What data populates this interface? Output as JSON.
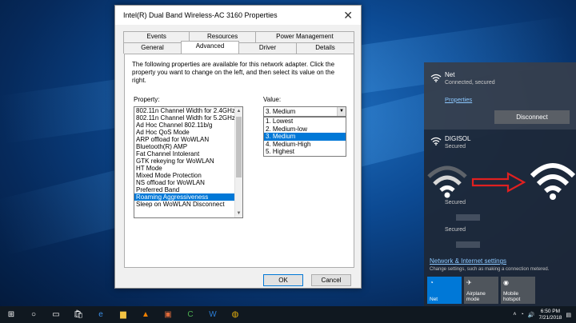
{
  "dialog": {
    "title": "Intel(R) Dual Band Wireless-AC 3160 Properties",
    "tabs_row1": [
      "Events",
      "Resources",
      "Power Management"
    ],
    "tabs_row2": [
      "General",
      "Advanced",
      "Driver",
      "Details"
    ],
    "active_tab": "Advanced",
    "description": "The following properties are available for this network adapter. Click the property you want to change on the left, and then select its value on the right.",
    "property_label": "Property:",
    "value_label": "Value:",
    "properties": [
      "802.11n Channel Width for 2.4GHz",
      "802.11n Channel Width for 5.2GHz",
      "Ad Hoc Channel 802.11b/g",
      "Ad Hoc QoS Mode",
      "ARP offload for WoWLAN",
      "Bluetooth(R) AMP",
      "Fat Channel Intolerant",
      "GTK rekeying for WoWLAN",
      "HT Mode",
      "Mixed Mode Protection",
      "NS offload for WoWLAN",
      "Preferred Band",
      "Roaming Aggressiveness",
      "Sleep on WoWLAN Disconnect"
    ],
    "selected_property": "Roaming Aggressiveness",
    "value_current": "3. Medium",
    "value_options": [
      "1. Lowest",
      "2. Medium-low",
      "3. Medium",
      "4. Medium-High",
      "5. Highest"
    ],
    "ok_label": "OK",
    "cancel_label": "Cancel"
  },
  "flyout": {
    "net1_name": "Net",
    "net1_status": "Connected, secured",
    "properties_link": "Properties",
    "disconnect_label": "Disconnect",
    "net2_name": "DIGISOL",
    "net2_status": "Secured",
    "net3_status": "Secured",
    "net4_status": "Secured",
    "settings_link": "Network & Internet settings",
    "settings_sub": "Change settings, such as making a connection metered.",
    "tiles": [
      {
        "label": "Net",
        "icon": "wifi-icon",
        "on": true
      },
      {
        "label": "Airplane mode",
        "icon": "airplane-icon",
        "on": false
      },
      {
        "label": "Mobile hotspot",
        "icon": "hotspot-icon",
        "on": false
      }
    ]
  },
  "taskbar": {
    "time": "6:50 PM",
    "date": "7/21/2018",
    "apps": [
      "start-icon",
      "search-icon",
      "task-view-icon",
      "store-icon",
      "edge-icon",
      "explorer-icon",
      "vlc-icon",
      "photo-icon",
      "camtasia-icon",
      "word-icon",
      "chrome-icon"
    ]
  },
  "colors": {
    "accent": "#0078d7",
    "arrow": "#e02020",
    "flyout_bg": "#1e2837"
  }
}
